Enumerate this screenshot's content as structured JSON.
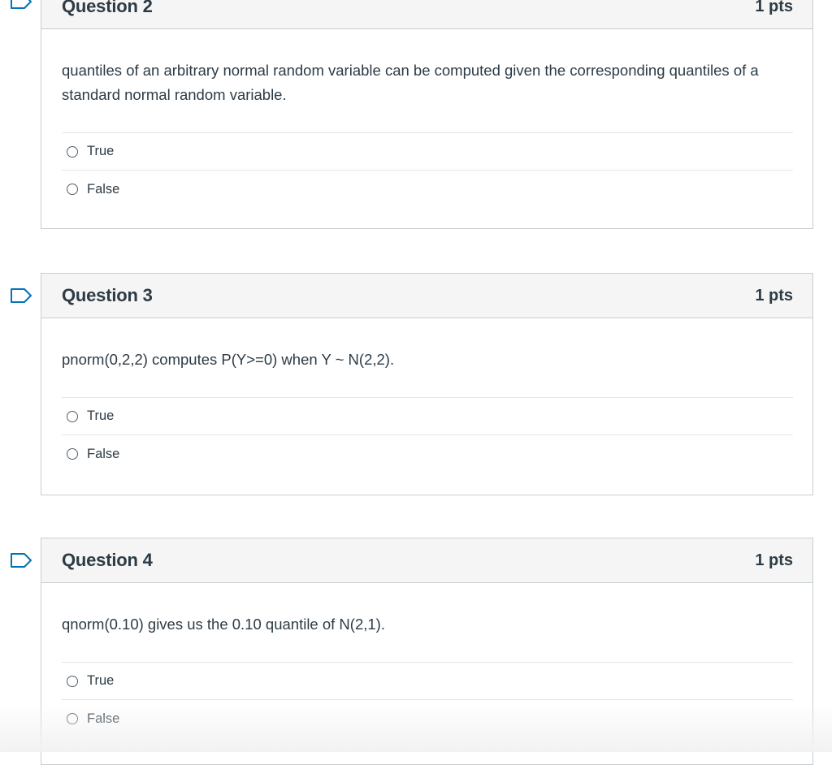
{
  "accent_color": "#0374b5",
  "questions": [
    {
      "title": "Question 2",
      "points": "1 pts",
      "text": "quantiles of an arbitrary normal random variable can be computed given the corresponding quantiles of a standard normal random variable.",
      "flag_icon": "bookmark-flag-icon",
      "answers": [
        {
          "label": "True",
          "selected": false
        },
        {
          "label": "False",
          "selected": false
        }
      ]
    },
    {
      "title": "Question 3",
      "points": "1 pts",
      "text": "pnorm(0,2,2) computes P(Y>=0) when Y ~ N(2,2).",
      "flag_icon": "bookmark-flag-icon",
      "answers": [
        {
          "label": "True",
          "selected": false
        },
        {
          "label": "False",
          "selected": false
        }
      ]
    },
    {
      "title": "Question 4",
      "points": "1 pts",
      "text": "qnorm(0.10) gives us the 0.10 quantile of N(2,1).",
      "flag_icon": "bookmark-flag-icon",
      "answers": [
        {
          "label": "True",
          "selected": false
        },
        {
          "label": "False",
          "selected": false
        }
      ]
    }
  ]
}
